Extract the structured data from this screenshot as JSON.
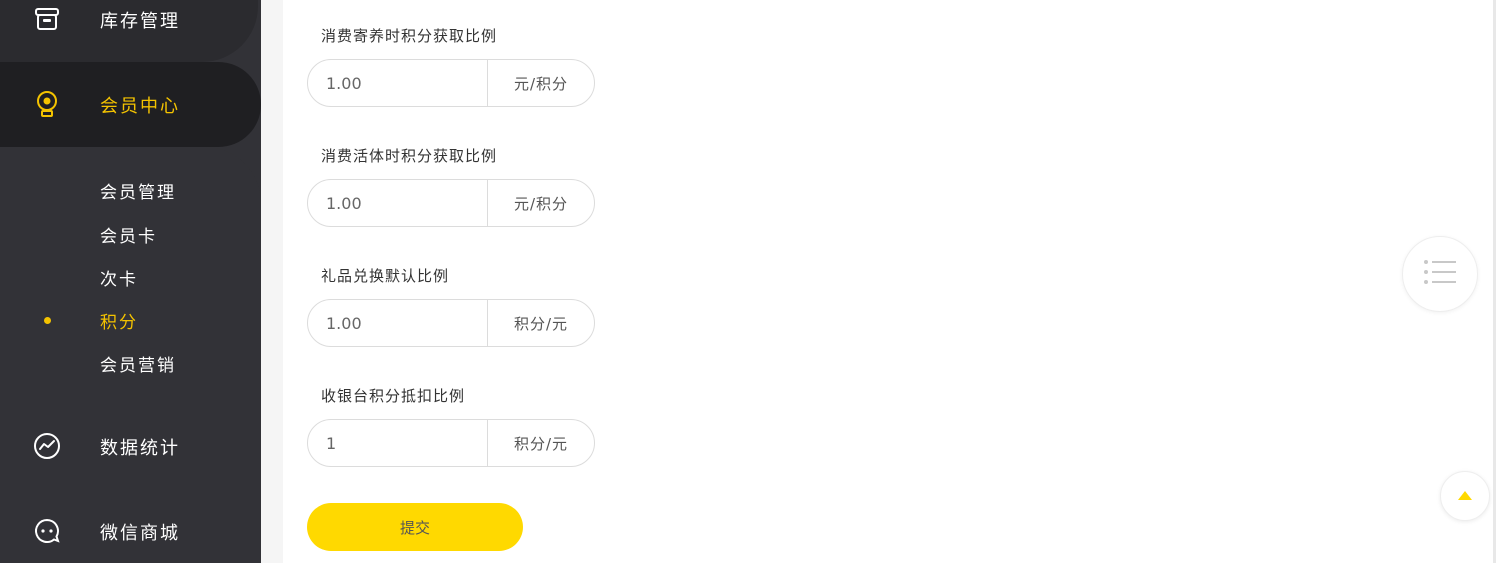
{
  "sidebar": {
    "top_item": {
      "label": "库存管理",
      "icon": "inventory-box-icon"
    },
    "active_item": {
      "label": "会员中心",
      "icon": "member-lightbulb-icon"
    },
    "submenu": [
      {
        "label": "会员管理"
      },
      {
        "label": "会员卡"
      },
      {
        "label": "次卡"
      },
      {
        "label": "积分"
      },
      {
        "label": "会员营销"
      }
    ],
    "items": [
      {
        "label": "数据统计",
        "icon": "statistics-chart-icon"
      },
      {
        "label": "微信商城",
        "icon": "wechat-mall-icon"
      }
    ]
  },
  "form": {
    "fields": [
      {
        "label": "消费寄养时积分获取比例",
        "value": "1.00",
        "unit": "元/积分"
      },
      {
        "label": "消费活体时积分获取比例",
        "value": "1.00",
        "unit": "元/积分"
      },
      {
        "label": "礼品兑换默认比例",
        "value": "1.00",
        "unit": "积分/元"
      },
      {
        "label": "收银台积分抵扣比例",
        "value": "1",
        "unit": "积分/元"
      }
    ],
    "submit_label": "提交"
  },
  "floating": {
    "toc_icon": "list-icon",
    "top_icon": "arrow-up-icon"
  },
  "colors": {
    "accent": "#f4c300",
    "button": "#ffd900",
    "sidebar_bg": "#323237"
  }
}
